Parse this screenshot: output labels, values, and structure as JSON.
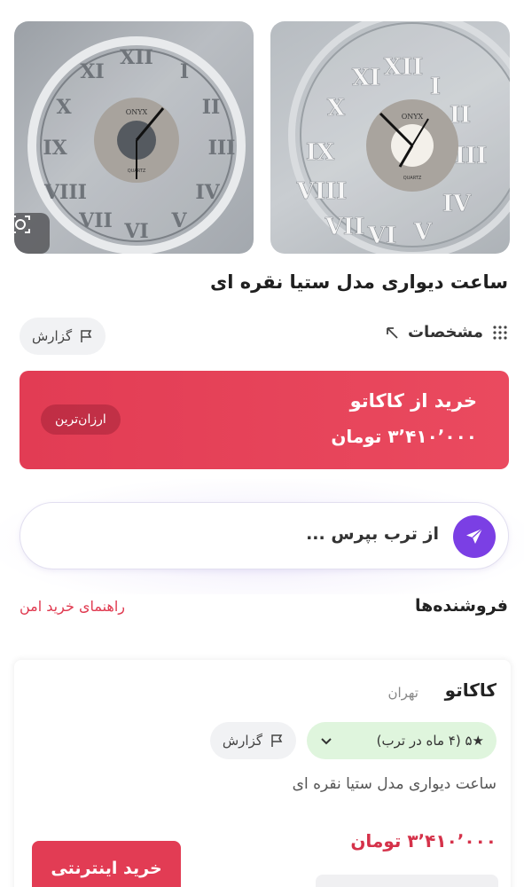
{
  "product": {
    "title": "ساعت دیواری مدل ستیا نقره ای",
    "images": [
      {
        "brand_text": "ONYX",
        "sub_text": "QUARTZ"
      },
      {
        "brand_text": "ONYX",
        "sub_text": "QUARTZ"
      }
    ]
  },
  "actions": {
    "specs_label": "مشخصات",
    "report_label": "گزارش"
  },
  "best_offer": {
    "shop_label": "خرید از کاکاتو",
    "price": "۳٬۴۱۰٬۰۰۰ تومان",
    "badge": "ارزان‌ترین"
  },
  "ask": {
    "placeholder": "از ترب بپرس ..."
  },
  "sellers": {
    "heading": "فروشنده‌ها",
    "guide_link": "راهنمای خرید امن",
    "items": [
      {
        "name": "کاکاتو",
        "city": "تهران",
        "rating": "★۵ (۴ ماه در ترب)",
        "report_label": "گزارش",
        "product_name": "ساعت دیواری مدل ستیا نقره ای",
        "price": "۳٬۴۱۰٬۰۰۰ تومان",
        "buy_label": "خرید اینترنتی"
      }
    ]
  },
  "colors": {
    "accent_red": "#e23c54",
    "accent_purple": "#7b3fe4",
    "rating_green": "#dff5dd"
  }
}
